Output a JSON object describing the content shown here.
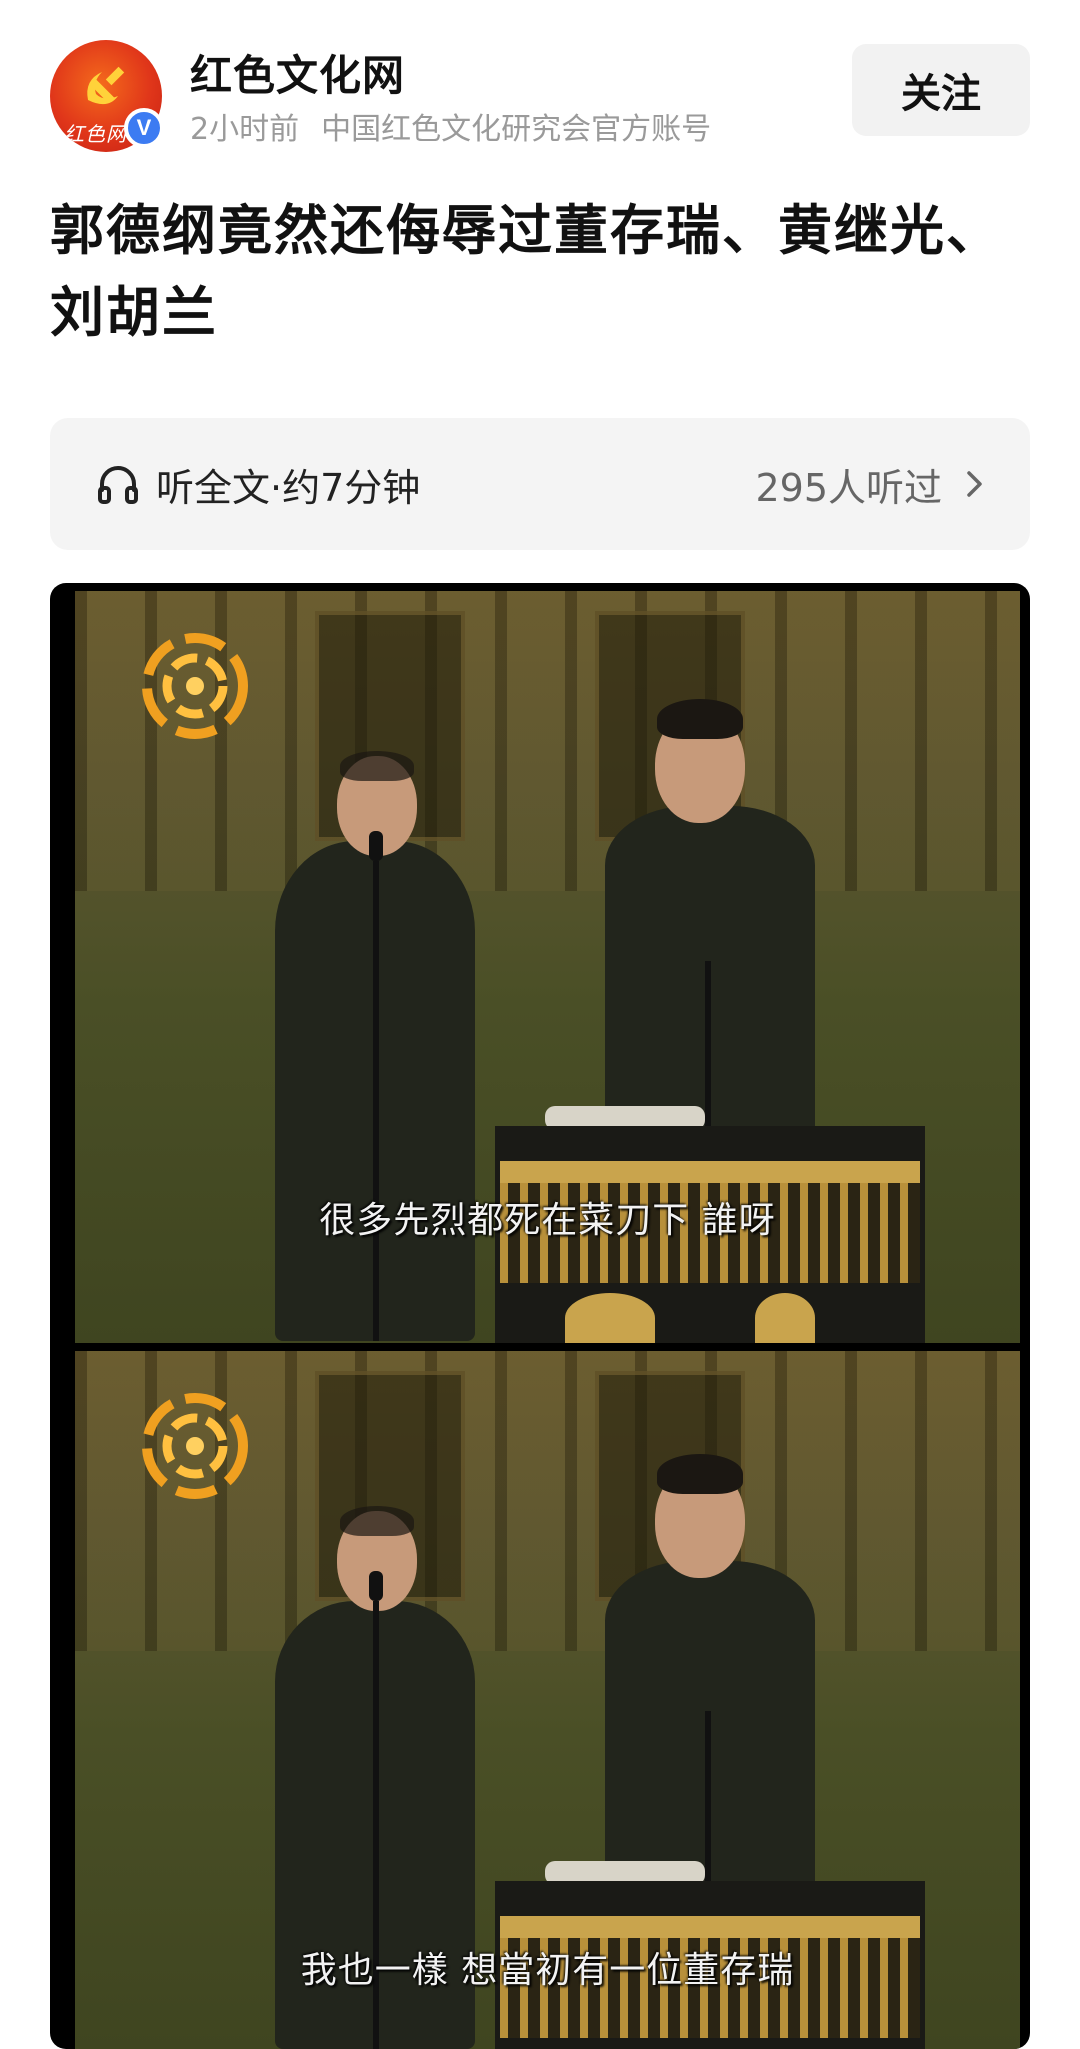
{
  "account": {
    "name": "红色文化网",
    "time": "2小时前",
    "description": "中国红色文化研究会官方账号",
    "avatar_text": "红色网",
    "verified_mark": "V"
  },
  "follow_button": {
    "label": "关注"
  },
  "article": {
    "title": "郭德纲竟然还侮辱过董存瑞、黄继光、刘胡兰"
  },
  "listen": {
    "label": "听全文·约7分钟",
    "count": "295人听过",
    "icon": "headphone-icon"
  },
  "media": {
    "frames": [
      {
        "subtitle": "很多先烈都死在菜刀下 誰呀"
      },
      {
        "subtitle": "我也一樣 想當初有一位董存瑞"
      }
    ]
  },
  "colors": {
    "verified": "#3c7bf2",
    "avatar_red": "#e0361a",
    "button_bg": "#f2f2f2",
    "listen_bg": "#f4f4f4",
    "meta_gray": "#9a9a9a"
  }
}
